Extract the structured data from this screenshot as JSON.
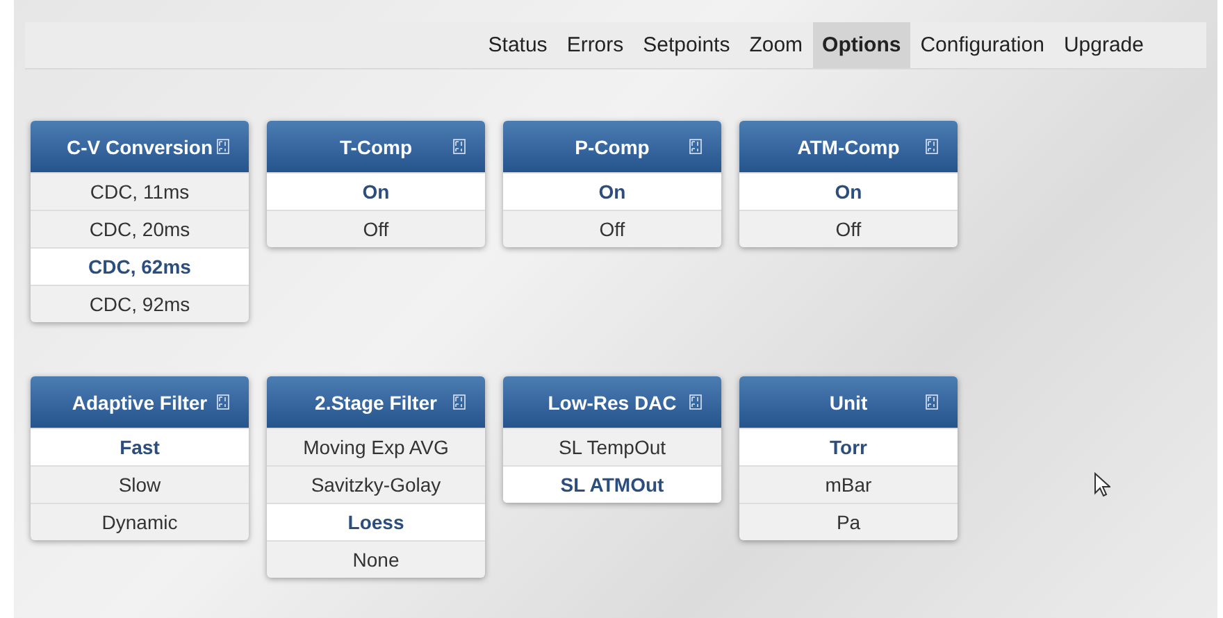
{
  "nav": [
    {
      "label": "Status",
      "selected": false
    },
    {
      "label": "Errors",
      "selected": false
    },
    {
      "label": "Setpoints",
      "selected": false
    },
    {
      "label": "Zoom",
      "selected": false
    },
    {
      "label": "Options",
      "selected": true
    },
    {
      "label": "Configuration",
      "selected": false
    },
    {
      "label": "Upgrade",
      "selected": false
    }
  ],
  "panel_rows": [
    [
      {
        "title": "C-V Conversion",
        "options": [
          {
            "label": "CDC, 11ms",
            "selected": false
          },
          {
            "label": "CDC, 20ms",
            "selected": false
          },
          {
            "label": "CDC, 62ms",
            "selected": true
          },
          {
            "label": "CDC, 92ms",
            "selected": false
          }
        ]
      },
      {
        "title": "T-Comp",
        "options": [
          {
            "label": "On",
            "selected": true
          },
          {
            "label": "Off",
            "selected": false
          }
        ]
      },
      {
        "title": "P-Comp",
        "options": [
          {
            "label": "On",
            "selected": true
          },
          {
            "label": "Off",
            "selected": false
          }
        ]
      },
      {
        "title": "ATM-Comp",
        "options": [
          {
            "label": "On",
            "selected": true
          },
          {
            "label": "Off",
            "selected": false
          }
        ]
      }
    ],
    [
      {
        "title": "Adaptive Filter",
        "options": [
          {
            "label": "Fast",
            "selected": true
          },
          {
            "label": "Slow",
            "selected": false
          },
          {
            "label": "Dynamic",
            "selected": false
          }
        ]
      },
      {
        "title": "2.Stage Filter",
        "options": [
          {
            "label": "Moving Exp AVG",
            "selected": false
          },
          {
            "label": "Savitzky-Golay",
            "selected": false
          },
          {
            "label": "Loess",
            "selected": true
          },
          {
            "label": "None",
            "selected": false
          }
        ]
      },
      {
        "title": "Low-Res DAC",
        "options": [
          {
            "label": "SL TempOut",
            "selected": false
          },
          {
            "label": "SL ATMOut",
            "selected": true
          }
        ]
      },
      {
        "title": "Unit",
        "options": [
          {
            "label": "Torr",
            "selected": true
          },
          {
            "label": "mBar",
            "selected": false
          },
          {
            "label": "Pa",
            "selected": false
          }
        ]
      }
    ]
  ]
}
